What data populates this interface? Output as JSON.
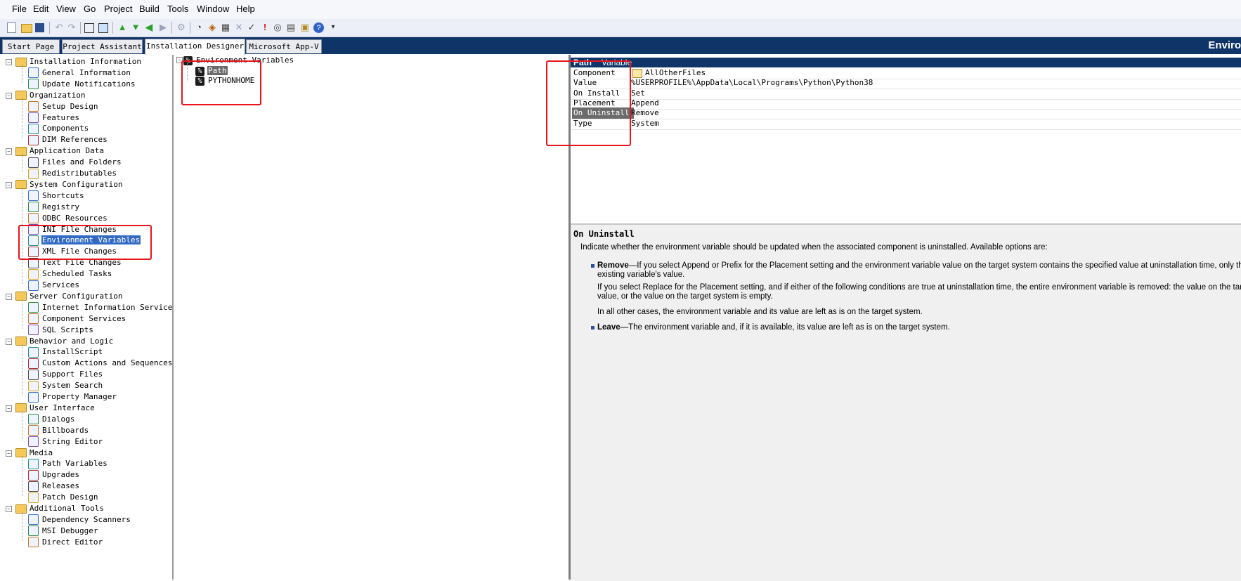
{
  "menu": [
    "File",
    "Edit",
    "View",
    "Go",
    "Project",
    "Build",
    "Tools",
    "Window",
    "Help"
  ],
  "tabs": [
    "Start Page",
    "Project Assistant",
    "Installation Designer",
    "Microsoft App-V"
  ],
  "view_title": "Enviro",
  "tree": {
    "groups": [
      {
        "label": "Installation Information",
        "items": [
          "General Information",
          "Update Notifications"
        ]
      },
      {
        "label": "Organization",
        "items": [
          "Setup Design",
          "Features",
          "Components",
          "DIM References"
        ]
      },
      {
        "label": "Application Data",
        "items": [
          "Files and Folders",
          "Redistributables"
        ]
      },
      {
        "label": "System Configuration",
        "items": [
          "Shortcuts",
          "Registry",
          "ODBC Resources",
          "INI File Changes",
          "Environment Variables",
          "XML File Changes",
          "Text File Changes",
          "Scheduled Tasks",
          "Services"
        ]
      },
      {
        "label": "Server Configuration",
        "items": [
          "Internet Information Services",
          "Component Services",
          "SQL Scripts"
        ]
      },
      {
        "label": "Behavior and Logic",
        "items": [
          "InstallScript",
          "Custom Actions and Sequences",
          "Support Files",
          "System Search",
          "Property Manager"
        ]
      },
      {
        "label": "User Interface",
        "items": [
          "Dialogs",
          "Billboards",
          "String Editor"
        ]
      },
      {
        "label": "Media",
        "items": [
          "Path Variables",
          "Upgrades",
          "Releases",
          "Patch Design"
        ]
      },
      {
        "label": "Additional Tools",
        "items": [
          "Dependency Scanners",
          "MSI Debugger",
          "Direct Editor"
        ]
      }
    ],
    "selected": "Environment Variables"
  },
  "env_tree": {
    "root": "Environment Variables",
    "children": [
      "Path",
      "PYTHONHOME"
    ],
    "selected": "Path"
  },
  "properties": {
    "header_name": "Path",
    "header_col": "Variable",
    "rows": [
      {
        "name": "Component",
        "value": "AllOtherFiles"
      },
      {
        "name": "Value",
        "value": "%USERPROFILE%\\AppData\\Local\\Programs\\Python\\Python38"
      },
      {
        "name": "On Install",
        "value": "Set"
      },
      {
        "name": "Placement",
        "value": "Append"
      },
      {
        "name": "On Uninstall",
        "value": "Remove"
      },
      {
        "name": "Type",
        "value": "System"
      }
    ],
    "selected": "On Uninstall"
  },
  "help": {
    "title": "On Uninstall",
    "intro": "Indicate whether the environment variable should be updated when the associated component is uninstalled. Available options are:",
    "remove_term": "Remove",
    "remove_text_1": "—If you select Append or Prefix for the Placement setting and the environment variable value on the target system contains the specified value at uninstallation time, only that value",
    "remove_text_2": "existing variable's value.",
    "replace_text_1": "If you select Replace for the Placement setting, and if either of the following conditions are true at uninstallation time, the entire environment variable is removed: the value on the target syst",
    "replace_text_2": "value, or the value on the target system is empty.",
    "other_text": "In all other cases, the environment variable and its value are left as is on the target system.",
    "leave_term": "Leave",
    "leave_text": "—The environment variable and, if it is available, its value are left as is on the target system."
  }
}
